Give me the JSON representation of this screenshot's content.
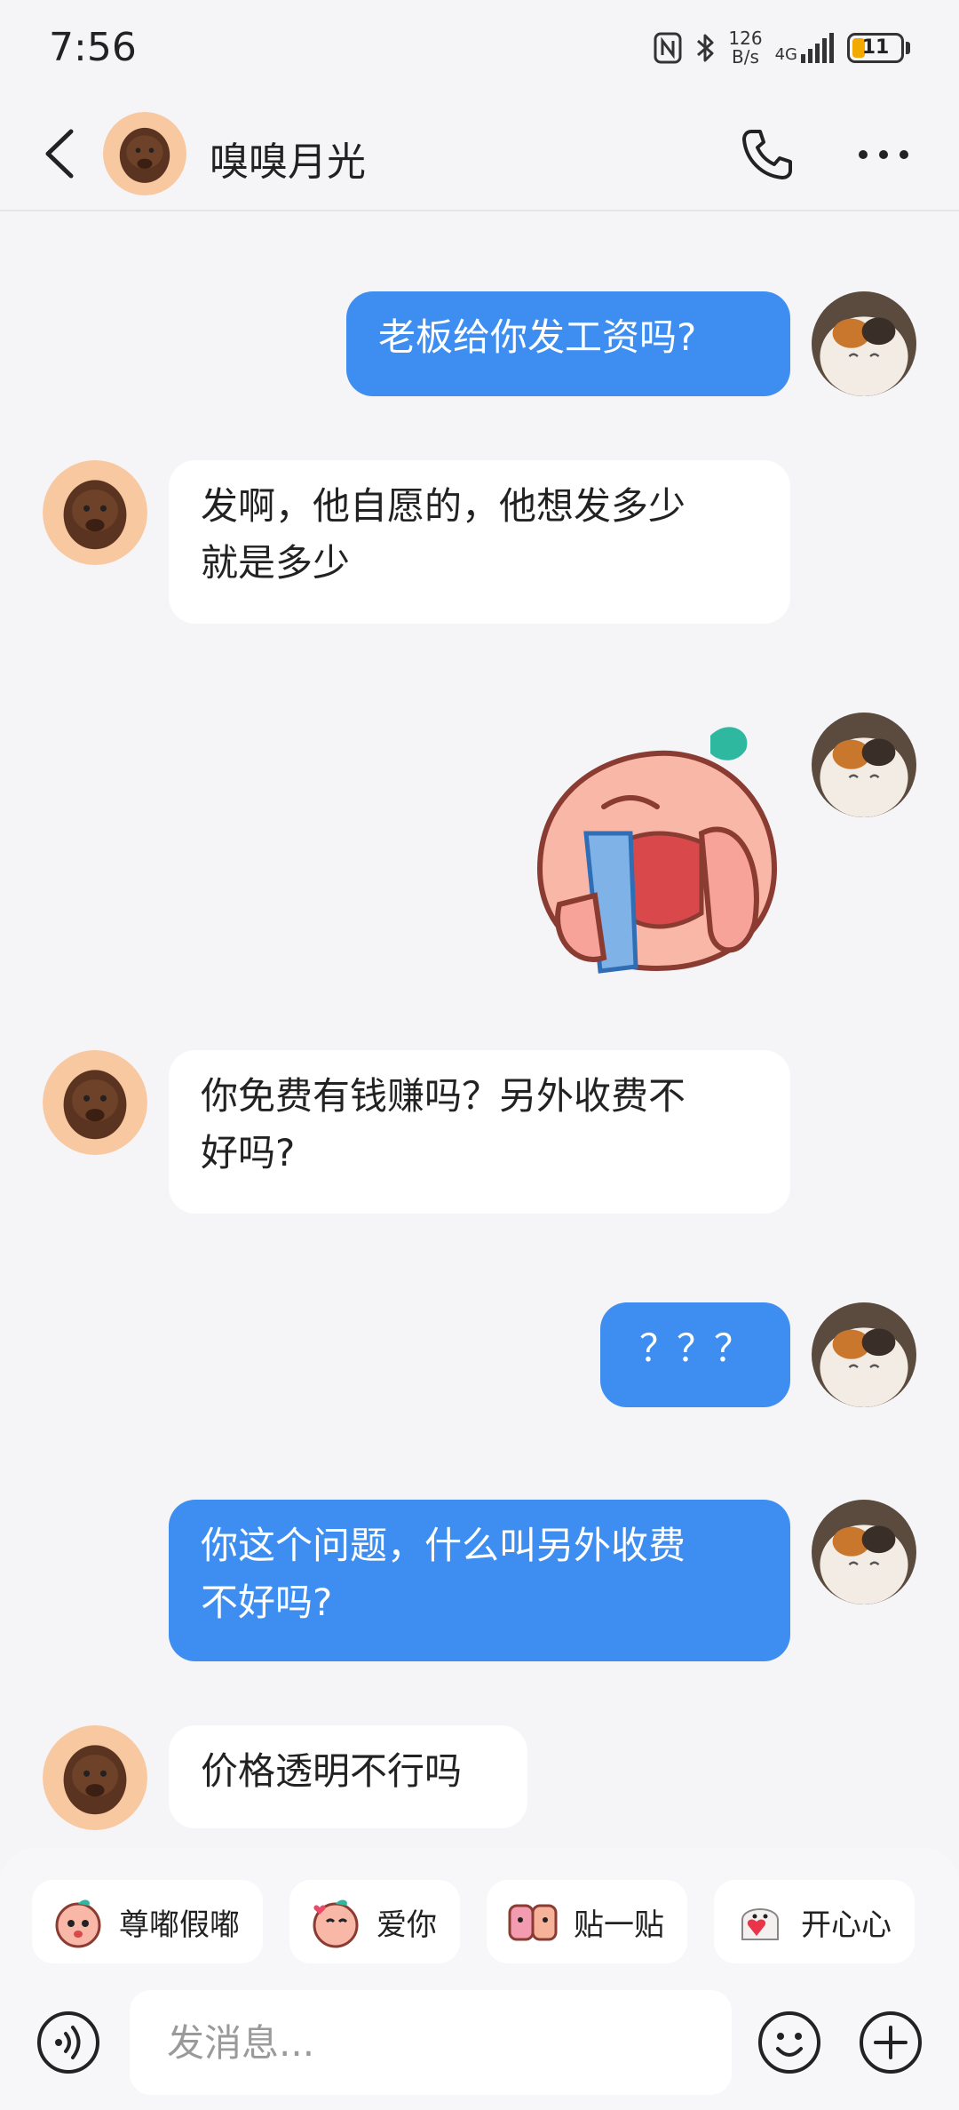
{
  "status_bar": {
    "time": "7:56",
    "net_speed_value": "126",
    "net_speed_unit": "B/s",
    "network": "4G",
    "battery": "11"
  },
  "header": {
    "contact_name": "嗅嗅月光"
  },
  "messages": [
    {
      "side": "out",
      "type": "text",
      "text": "老板给你发工资吗?"
    },
    {
      "side": "in",
      "type": "text",
      "text": "发啊，他自愿的，他想发多少\n就是多少"
    },
    {
      "side": "out",
      "type": "sticker",
      "sticker": "crying-peach-sticker"
    },
    {
      "side": "in",
      "type": "text",
      "text": "你免费有钱赚吗？另外收费不\n好吗?"
    },
    {
      "side": "out",
      "type": "text",
      "text": "？？？"
    },
    {
      "side": "out",
      "type": "text",
      "text": "你这个问题，什么叫另外收费\n不好吗?"
    },
    {
      "side": "in",
      "type": "text",
      "text": "价格透明不行吗"
    }
  ],
  "quick_stickers": [
    {
      "label": "尊嘟假嘟",
      "icon": "peach-face-icon"
    },
    {
      "label": "爱你",
      "icon": "peach-heart-icon"
    },
    {
      "label": "贴一贴",
      "icon": "two-faces-icon"
    },
    {
      "label": "开心心",
      "icon": "happy-ghost-icon"
    }
  ],
  "composer": {
    "placeholder": "发消息..."
  },
  "colors": {
    "outgoing_bubble": "#3d8ef0",
    "incoming_bubble": "#ffffff",
    "background": "#f5f5f7",
    "battery_low": "#f2a900"
  }
}
